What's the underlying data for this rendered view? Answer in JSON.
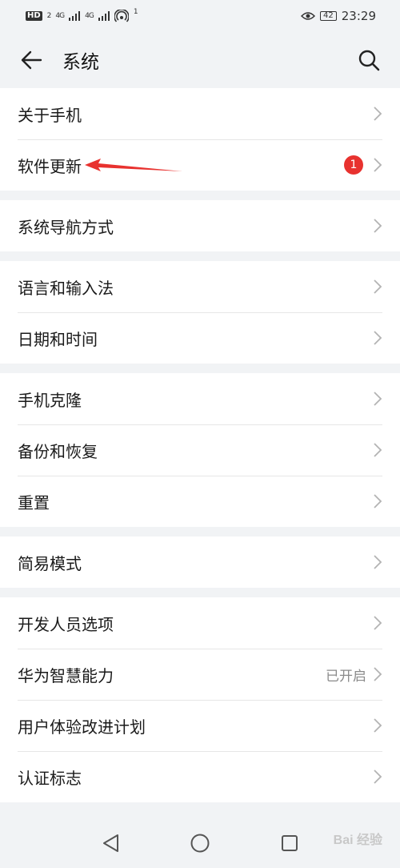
{
  "status_bar": {
    "hd": "HD",
    "sim": "2",
    "signal1": "4G",
    "signal2": "4G",
    "hotspot_count": "1",
    "battery": "42",
    "time": "23:29"
  },
  "header": {
    "title": "系统"
  },
  "groups": [
    [
      {
        "label": "关于手机"
      },
      {
        "label": "软件更新",
        "badge": "1"
      }
    ],
    [
      {
        "label": "系统导航方式"
      }
    ],
    [
      {
        "label": "语言和输入法"
      },
      {
        "label": "日期和时间"
      }
    ],
    [
      {
        "label": "手机克隆"
      },
      {
        "label": "备份和恢复"
      },
      {
        "label": "重置"
      }
    ],
    [
      {
        "label": "简易模式"
      }
    ],
    [
      {
        "label": "开发人员选项"
      },
      {
        "label": "华为智慧能力",
        "value": "已开启"
      },
      {
        "label": "用户体验改进计划"
      },
      {
        "label": "认证标志"
      }
    ]
  ],
  "watermark": "Bai 经验",
  "colors": {
    "badge": "#e8322f",
    "background": "#f1f3f5",
    "annotation_arrow": "#e8322f"
  }
}
